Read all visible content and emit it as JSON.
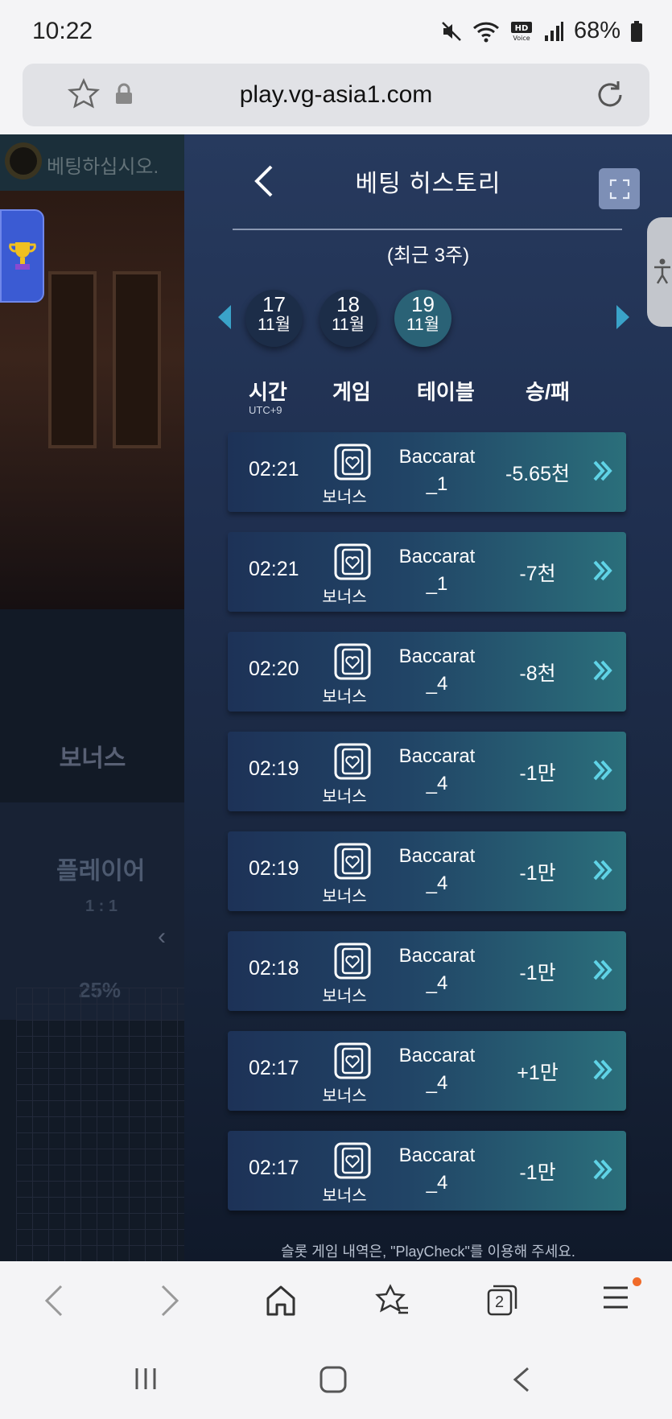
{
  "status_bar": {
    "time": "10:22",
    "battery": "68%"
  },
  "browser": {
    "url": "play.vg-asia1.com"
  },
  "left_panel": {
    "banner_text": "베팅하십시오.",
    "bonus_label": "보너스",
    "player_label": "플레이어",
    "player_odds": "1 : 1",
    "player_percent": "25%"
  },
  "history": {
    "title": "베팅 히스토리",
    "subtitle": "(최근 3주)",
    "dates": [
      {
        "day": "17",
        "month": "11월"
      },
      {
        "day": "18",
        "month": "11월"
      },
      {
        "day": "19",
        "month": "11월"
      }
    ],
    "selected_date_index": 2,
    "headers": {
      "time": "시간",
      "timezone": "UTC+9",
      "game": "게임",
      "table": "테이블",
      "result": "승/패"
    },
    "rows": [
      {
        "time": "02:21",
        "game": "보너스",
        "table_line1": "Baccarat",
        "table_line2": "_1",
        "result": "-5.65천"
      },
      {
        "time": "02:21",
        "game": "보너스",
        "table_line1": "Baccarat",
        "table_line2": "_1",
        "result": "-7천"
      },
      {
        "time": "02:20",
        "game": "보너스",
        "table_line1": "Baccarat",
        "table_line2": "_4",
        "result": "-8천"
      },
      {
        "time": "02:19",
        "game": "보너스",
        "table_line1": "Baccarat",
        "table_line2": "_4",
        "result": "-1만"
      },
      {
        "time": "02:19",
        "game": "보너스",
        "table_line1": "Baccarat",
        "table_line2": "_4",
        "result": "-1만"
      },
      {
        "time": "02:18",
        "game": "보너스",
        "table_line1": "Baccarat",
        "table_line2": "_4",
        "result": "-1만"
      },
      {
        "time": "02:17",
        "game": "보너스",
        "table_line1": "Baccarat",
        "table_line2": "_4",
        "result": "+1만"
      },
      {
        "time": "02:17",
        "game": "보너스",
        "table_line1": "Baccarat",
        "table_line2": "_4",
        "result": "-1만"
      }
    ],
    "footnote": "슬롯 게임 내역은, \"PlayCheck\"를 이용해 주세요."
  },
  "browser_nav": {
    "tab_count": "2",
    "icons": [
      "back-icon",
      "forward-icon",
      "home-icon",
      "bookmarks-icon",
      "tabs-icon",
      "menu-icon"
    ]
  },
  "colors": {
    "panel_top": "#273a5e",
    "row_left": "#1d3257",
    "row_right": "#2b6f7b",
    "accent": "#5fd3e6",
    "active_date": "#2a6276"
  }
}
